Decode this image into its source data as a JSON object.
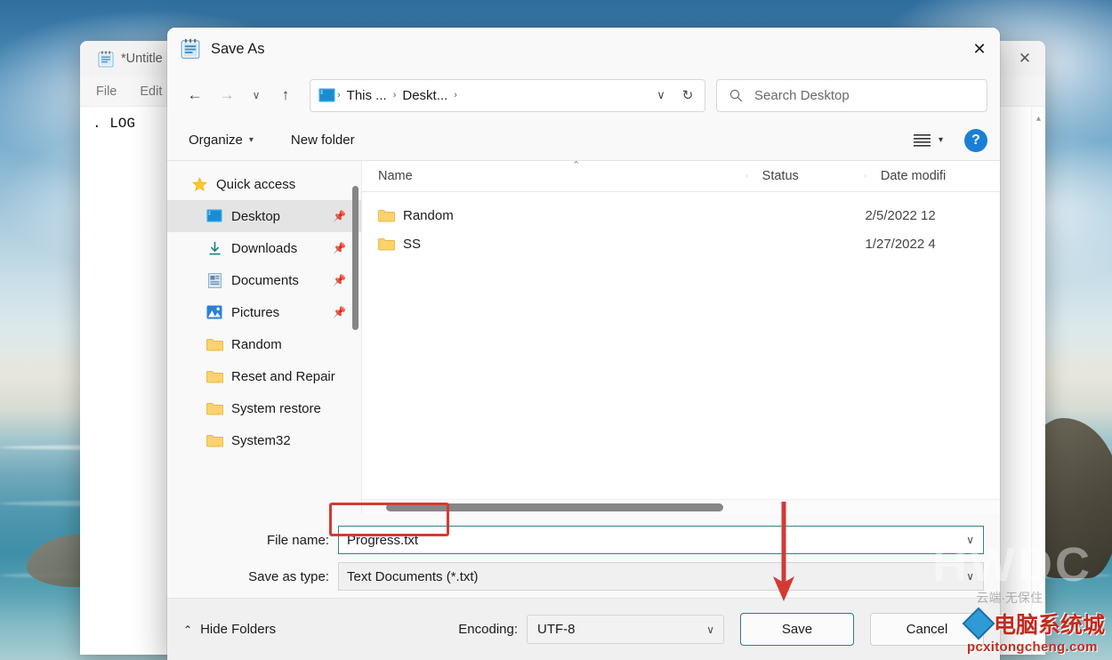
{
  "desktop": {
    "wallpaper_alt": "beach-sunset-wallpaper"
  },
  "notepad": {
    "tab_title": "*Untitle",
    "menus": [
      "File",
      "Edit"
    ],
    "content": ". LOG",
    "close_label": "✕",
    "scroll_up_glyph": "▲",
    "icon_name": "notepad-icon"
  },
  "dialog": {
    "title": "Save As",
    "icon_name": "notepad-icon",
    "close_label": "✕",
    "nav": {
      "back_label": "←",
      "forward_label": "→",
      "recent_label": "∨",
      "up_label": "↑"
    },
    "address": {
      "icon_name": "desktop-folder-icon",
      "crumbs": [
        "This ...",
        "Deskt..."
      ],
      "separator": "›",
      "dropdown_label": "∨",
      "refresh_label": "↻"
    },
    "search": {
      "placeholder": "Search Desktop",
      "icon_name": "search-icon"
    },
    "commandbar": {
      "organize_label": "Organize",
      "organize_caret": "▾",
      "new_folder_label": "New folder",
      "layout_icon": "list-view-icon",
      "layout_caret": "▾",
      "help_label": "?"
    },
    "nav_pane": {
      "items": [
        {
          "label": "Quick access",
          "icon": "star-icon",
          "pinned": false,
          "selected": false,
          "indent": 0
        },
        {
          "label": "Desktop",
          "icon": "desktop-icon",
          "pinned": true,
          "selected": true,
          "indent": 1
        },
        {
          "label": "Downloads",
          "icon": "download-icon",
          "pinned": true,
          "selected": false,
          "indent": 1
        },
        {
          "label": "Documents",
          "icon": "document-icon",
          "pinned": true,
          "selected": false,
          "indent": 1
        },
        {
          "label": "Pictures",
          "icon": "picture-icon",
          "pinned": true,
          "selected": false,
          "indent": 1
        },
        {
          "label": "Random",
          "icon": "folder-icon",
          "pinned": false,
          "selected": false,
          "indent": 1
        },
        {
          "label": "Reset and Repair",
          "icon": "folder-icon",
          "pinned": false,
          "selected": false,
          "indent": 1
        },
        {
          "label": "System restore",
          "icon": "folder-icon",
          "pinned": false,
          "selected": false,
          "indent": 1
        },
        {
          "label": "System32",
          "icon": "folder-icon",
          "pinned": false,
          "selected": false,
          "indent": 1
        }
      ]
    },
    "file_list": {
      "columns": [
        "Name",
        "Status",
        "Date modifi"
      ],
      "sort_caret": "⌃",
      "rows": [
        {
          "name": "Random",
          "icon": "folder-icon",
          "status": "",
          "date": "2/5/2022 12"
        },
        {
          "name": "SS",
          "icon": "folder-icon",
          "status": "",
          "date": "1/27/2022 4"
        }
      ]
    },
    "form": {
      "filename_label": "File name:",
      "filename_value": "Progress.txt",
      "filename_caret": "∨",
      "filetype_label": "Save as type:",
      "filetype_value": "Text Documents (*.txt)",
      "filetype_caret": "∨"
    },
    "footer": {
      "hide_folders_label": "Hide Folders",
      "hide_folders_caret": "⌃",
      "encoding_label": "Encoding:",
      "encoding_value": "UTF-8",
      "encoding_caret": "∨",
      "save_label": "Save",
      "cancel_label": "Cancel"
    }
  },
  "annotations": {
    "highlight_target": "filename-field",
    "arrow_target": "save-button",
    "color": "#d33a34"
  },
  "watermark": {
    "brand": "HWDC",
    "chinese_small": "云端·无保住",
    "chinese_logo": "电脑系统城",
    "url": "pcxitongcheng.com"
  }
}
